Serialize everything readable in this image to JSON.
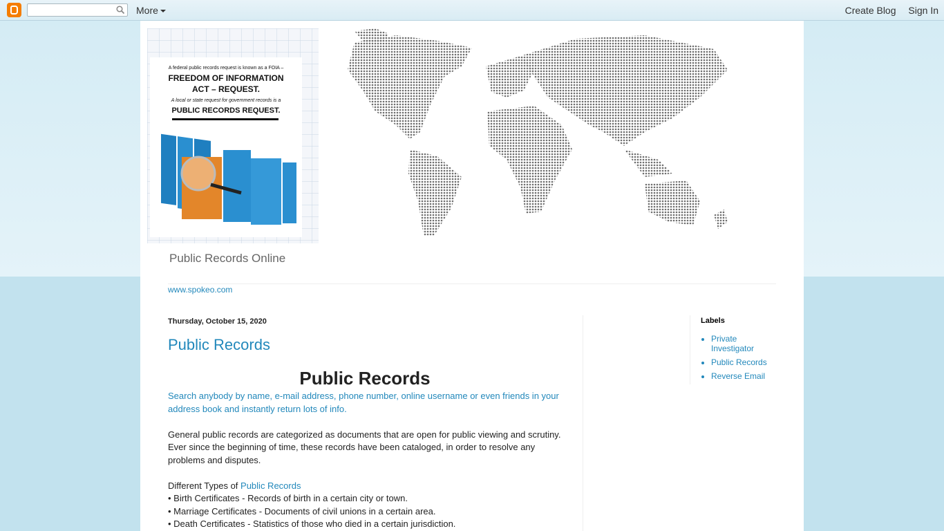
{
  "navbar": {
    "logo_icon": "blogger-icon",
    "search_placeholder": "",
    "more_label": "More",
    "create_blog": "Create Blog",
    "sign_in": "Sign In"
  },
  "header": {
    "image_title": "FREEDOM OF INFORMATION ACT – REQUEST.",
    "image_line1": "A federal public records request is known as a FOIA –",
    "image_line2": "A local or state request for government records is a",
    "image_line3": "PUBLIC RECORDS REQUEST.",
    "blog_title": "Public Records Online"
  },
  "tabs": {
    "link": "www.spokeo.com"
  },
  "post": {
    "date": "Thursday, October 15, 2020",
    "title": "Public Records",
    "heading": "Public Records",
    "intro_link": "Search anybody by name, e-mail address, phone number, online username or even friends in your address book and instantly return lots of info.",
    "paragraph1": "General public records are categorized as documents that are open for public viewing and scrutiny. Ever since the beginning of time, these records have been cataloged, in order to resolve any problems and disputes.",
    "types_prefix": "Different Types of ",
    "types_link": "Public Records",
    "bullets": [
      "• Birth Certificates - Records of birth in a certain city or town.",
      "• Marriage Certificates - Documents of civil unions in a certain area.",
      "• Death Certificates - Statistics of those who died in a certain jurisdiction."
    ]
  },
  "sidebar": {
    "labels_title": "Labels",
    "labels": [
      "Private Investigator",
      "Public Records",
      "Reverse Email"
    ]
  },
  "colors": {
    "accent": "#2288bb",
    "page_bg": "#c2e2ee",
    "blogger_orange": "#f57d00"
  }
}
